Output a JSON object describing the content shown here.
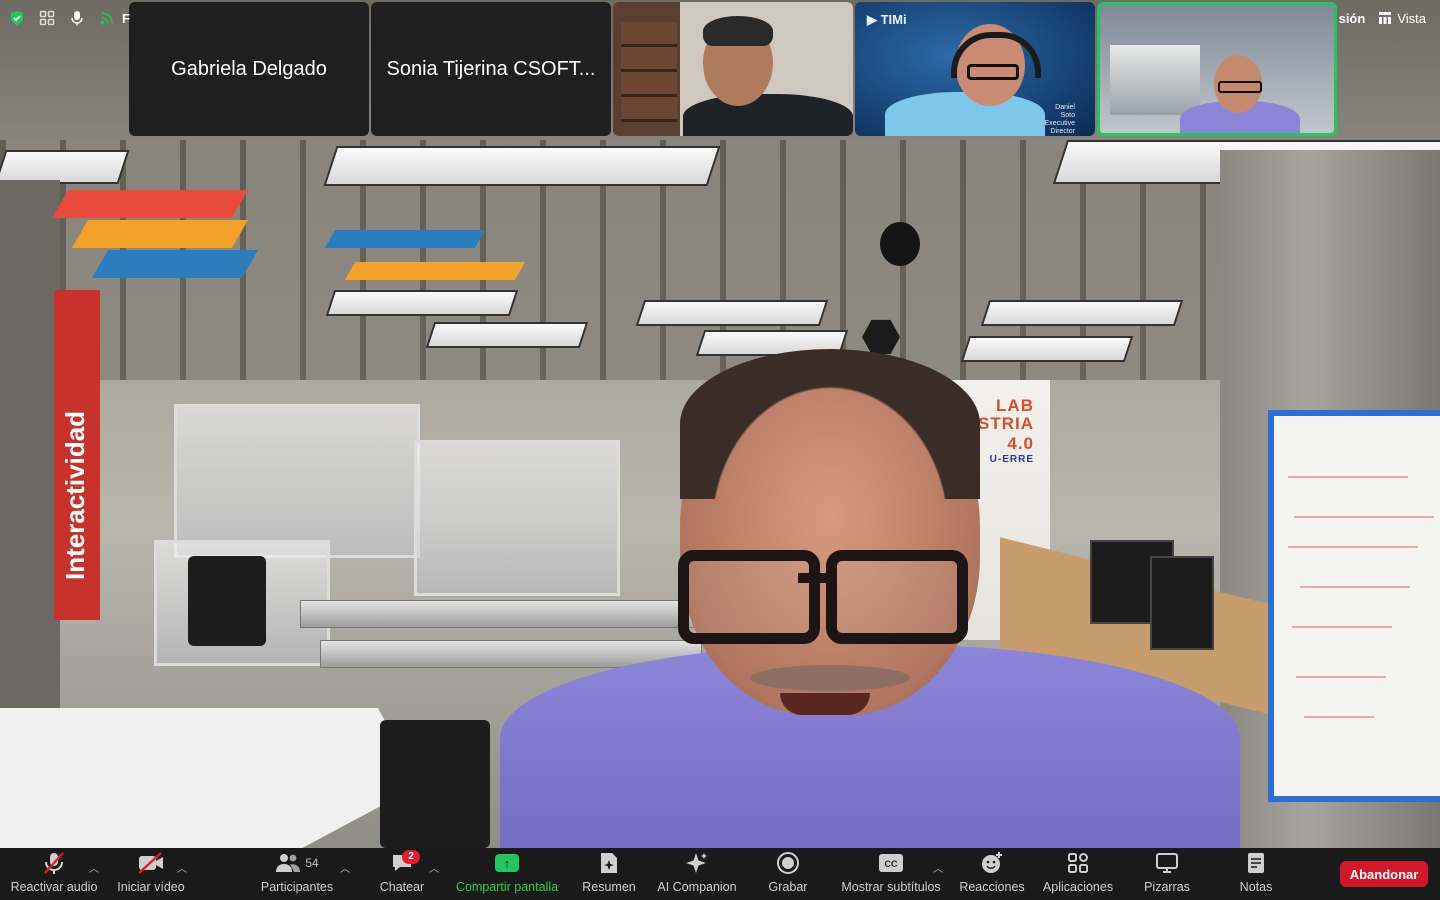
{
  "app": {
    "name": "Zoom",
    "accent_green": "#22c55e",
    "leave_red": "#d1182b"
  },
  "top_bar": {
    "left_icons": [
      "shield-check-icon",
      "grid-icon",
      "microphone-icon",
      "signal-icon"
    ],
    "left_text": "F",
    "right_text": "sión",
    "view_label": "Vista"
  },
  "participants_strip": [
    {
      "name": "Gabriela Delgado",
      "video": false
    },
    {
      "name": "Sonia Tijerina CSOFT...",
      "video": false
    },
    {
      "name": "",
      "video": true
    },
    {
      "name": "",
      "video": true,
      "logo": "TIMi",
      "caption": [
        "Daniel",
        "Soto",
        "Executive",
        "Director"
      ]
    },
    {
      "name": "",
      "video": true,
      "active_speaker": true
    }
  ],
  "main_video": {
    "banner_lines": [
      "LAB",
      "INDUSTRIA",
      "4.0",
      "U-ERRE"
    ],
    "pillar_text": "Interactividad"
  },
  "toolbar": {
    "items": [
      {
        "label": "Reactivar audio",
        "icon": "muted-microphone-icon"
      },
      {
        "label": "Iniciar vídeo",
        "icon": "video-off-icon"
      },
      {
        "label": "Participantes",
        "icon": "participants-icon",
        "count": "54"
      },
      {
        "label": "Chatear",
        "icon": "chat-icon",
        "badge": "2"
      },
      {
        "label": "Compartir pantalla",
        "icon": "share-screen-icon"
      },
      {
        "label": "Resumen",
        "icon": "summary-icon"
      },
      {
        "label": "AI Companion",
        "icon": "ai-sparkle-icon"
      },
      {
        "label": "Grabar",
        "icon": "record-icon"
      },
      {
        "label": "Mostrar subtítulos",
        "icon": "cc-icon"
      },
      {
        "label": "Reacciones",
        "icon": "reaction-icon"
      },
      {
        "label": "Aplicaciones",
        "icon": "apps-icon"
      },
      {
        "label": "Pizarras",
        "icon": "whiteboard-icon"
      },
      {
        "label": "Notas",
        "icon": "notes-icon"
      }
    ],
    "leave_label": "Abandonar"
  }
}
